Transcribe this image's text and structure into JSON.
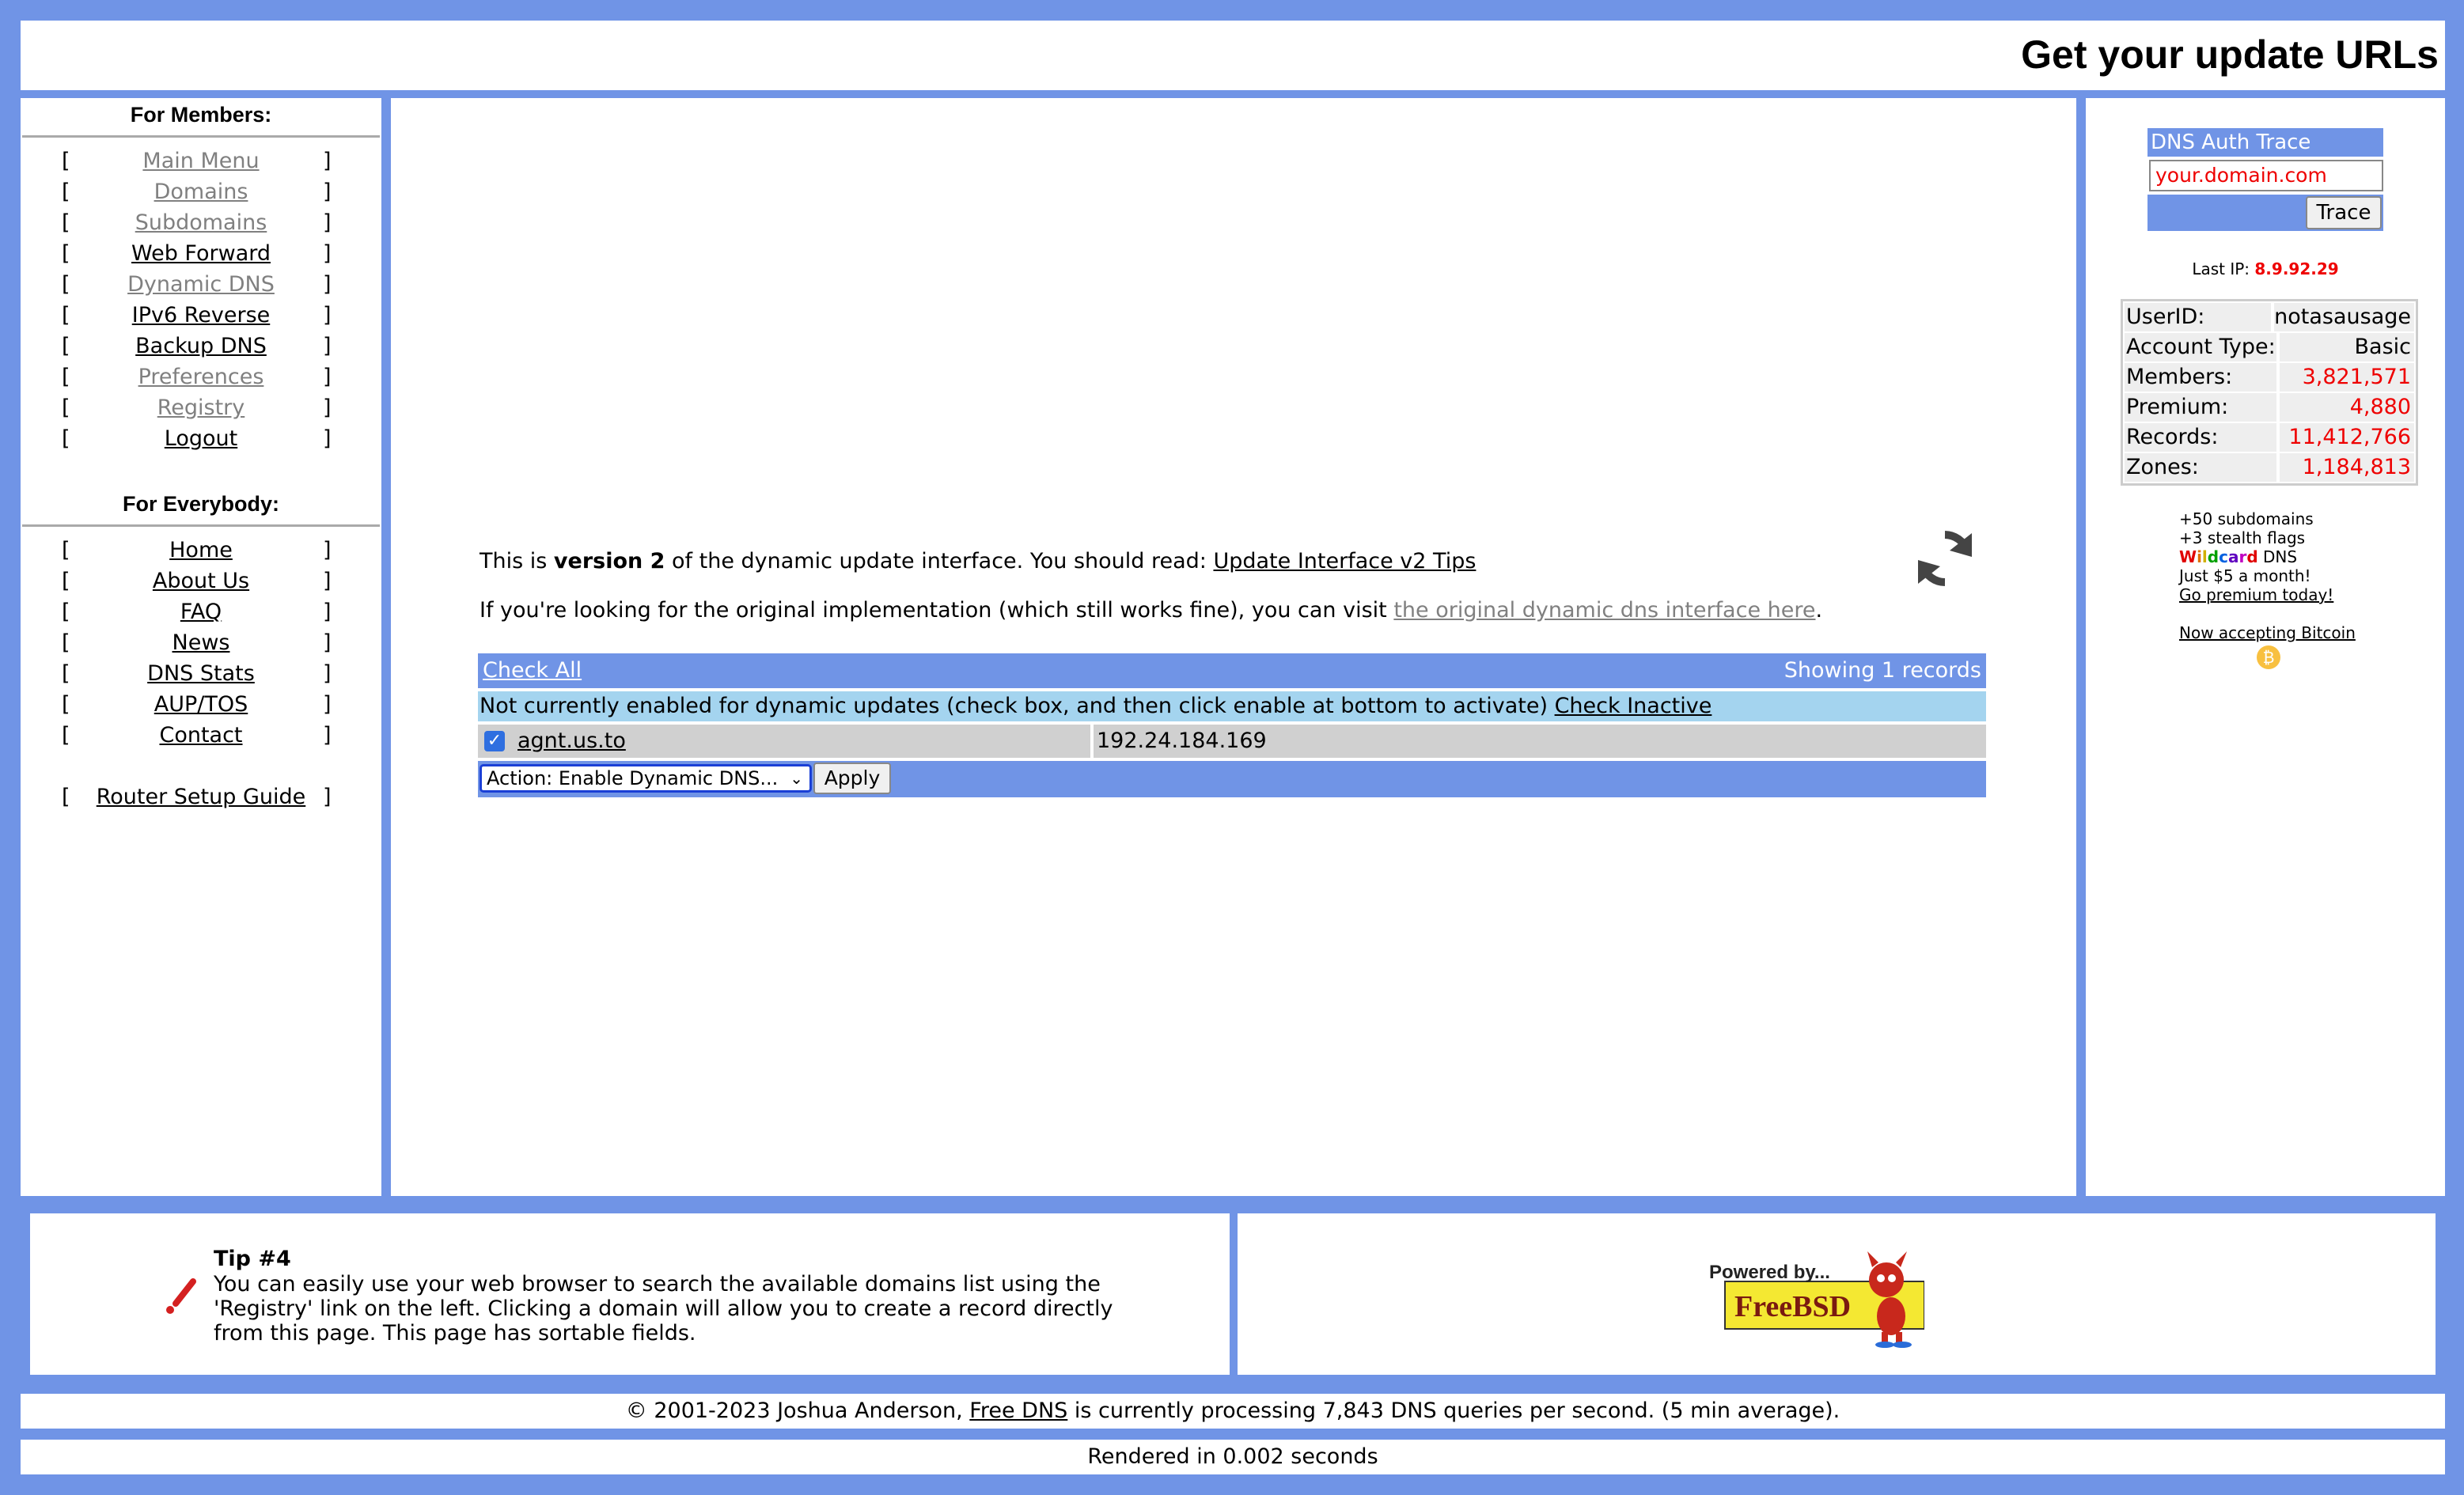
{
  "header": {
    "title": "Get your update URLs"
  },
  "members_nav": {
    "heading": "For Members:",
    "items": [
      {
        "label": "Main Menu",
        "style": "grey"
      },
      {
        "label": "Domains",
        "style": "grey"
      },
      {
        "label": "Subdomains",
        "style": "grey"
      },
      {
        "label": "Web Forward",
        "style": "black"
      },
      {
        "label": "Dynamic DNS",
        "style": "grey"
      },
      {
        "label": "IPv6 Reverse",
        "style": "black"
      },
      {
        "label": "Backup DNS",
        "style": "black"
      },
      {
        "label": "Preferences",
        "style": "grey"
      },
      {
        "label": "Registry",
        "style": "grey"
      },
      {
        "label": "Logout",
        "style": "black"
      }
    ]
  },
  "everybody_nav": {
    "heading": "For Everybody:",
    "items": [
      {
        "label": "Home"
      },
      {
        "label": "About Us"
      },
      {
        "label": "FAQ"
      },
      {
        "label": "News"
      },
      {
        "label": "DNS Stats"
      },
      {
        "label": "AUP/TOS"
      },
      {
        "label": "Contact"
      }
    ],
    "router_guide": "Router Setup Guide"
  },
  "bracket_left": "[",
  "bracket_right": "]",
  "main": {
    "intro_prefix": "This is ",
    "intro_bold": "version 2",
    "intro_suffix": " of the dynamic update interface. You should read: ",
    "intro_link": "Update Interface v2 Tips",
    "original_prefix": "If you're looking for the original implementation (which still works fine), you can visit ",
    "original_link": "the original dynamic dns interface here",
    "original_suffix": ".",
    "check_all": "Check All",
    "showing": "Showing 1 records",
    "notice_text": "Not currently enabled for dynamic updates (check box, and then click enable at bottom to activate) ",
    "check_inactive": "Check Inactive",
    "records": [
      {
        "host": "agnt.us.to",
        "ip": "192.24.184.169",
        "checked": true
      }
    ],
    "action_select": "Action: Enable Dynamic DNS...",
    "apply_label": "Apply"
  },
  "right": {
    "trace_title": "DNS Auth Trace",
    "trace_placeholder": "your.domain.com",
    "trace_button": "Trace",
    "last_ip_label": "Last IP: ",
    "last_ip": "8.9.92.29",
    "stats": [
      {
        "key": "UserID:",
        "value": "notasausage",
        "red": false
      },
      {
        "key": "Account Type:",
        "value": "Basic",
        "red": false
      },
      {
        "key": "Members:",
        "value": "3,821,571",
        "red": true
      },
      {
        "key": "Premium:",
        "value": "4,880",
        "red": true
      },
      {
        "key": "Records:",
        "value": "11,412,766",
        "red": true
      },
      {
        "key": "Zones:",
        "value": "1,184,813",
        "red": true
      }
    ],
    "promo_line1": "+50 subdomains",
    "promo_line2": "+3 stealth flags",
    "promo_wildcard_letters": [
      "W",
      "i",
      "l",
      "d",
      "c",
      "a",
      "r",
      "d"
    ],
    "promo_wildcard_suffix": " DNS",
    "promo_line4": "Just $5 a month!",
    "promo_link": "Go premium today!",
    "bitcoin_link": "Now accepting Bitcoin"
  },
  "tip": {
    "title": "Tip #4",
    "text": "You can easily use your web browser to search the available domains list using the 'Registry' link on the left. Clicking a domain will allow you to create a record directly from this page. This page has sortable fields."
  },
  "powered": {
    "line1": "Powered by...",
    "logo_text": "FreeBSD"
  },
  "footer": {
    "prefix": "© 2001-2023 Joshua Anderson, ",
    "link": "Free DNS",
    "suffix": " is currently processing 7,843 DNS queries per second. (5 min average)."
  },
  "rendered": "Rendered in 0.002 seconds",
  "colors": {
    "frame": "#7094e6",
    "notice": "#a4d4ef",
    "stat_red": "#e00000",
    "wildcard": [
      "#e00000",
      "#e07000",
      "#d0b000",
      "#00a000",
      "#0060e0",
      "#6000c0",
      "#c000c0",
      "#e00000"
    ]
  }
}
